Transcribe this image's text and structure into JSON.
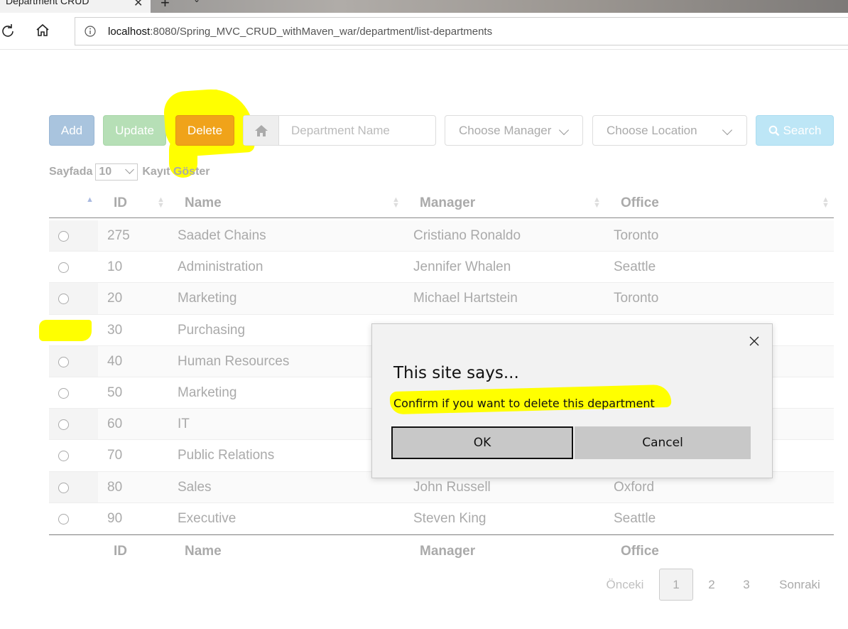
{
  "browser": {
    "tab_title": "Department CRUD",
    "url_host": "localhost",
    "url_rest": ":8080/Spring_MVC_CRUD_withMaven_war/department/list-departments"
  },
  "toolbar": {
    "add_label": "Add",
    "update_label": "Update",
    "delete_label": "Delete",
    "dept_placeholder": "Department Name",
    "manager_select": "Choose Manager",
    "location_select": "Choose Location",
    "search_label": "Search"
  },
  "length": {
    "prefix": "Sayfada",
    "value": "10",
    "suffix": "Kayıt Göster"
  },
  "table": {
    "headers": [
      "ID",
      "Name",
      "Manager",
      "Office"
    ],
    "rows": [
      {
        "id": "275",
        "name": "Saadet Chains",
        "manager": "Cristiano Ronaldo",
        "office": "Toronto",
        "checked": false
      },
      {
        "id": "10",
        "name": "Administration",
        "manager": "Jennifer Whalen",
        "office": "Seattle",
        "checked": false
      },
      {
        "id": "20",
        "name": "Marketing",
        "manager": "Michael Hartstein",
        "office": "Toronto",
        "checked": false
      },
      {
        "id": "30",
        "name": "Purchasing",
        "manager": "",
        "office": "",
        "checked": true
      },
      {
        "id": "40",
        "name": "Human Resources",
        "manager": "",
        "office": "",
        "checked": false
      },
      {
        "id": "50",
        "name": "Marketing",
        "manager": "",
        "office": "",
        "checked": false
      },
      {
        "id": "60",
        "name": "IT",
        "manager": "",
        "office": "",
        "checked": false
      },
      {
        "id": "70",
        "name": "Public Relations",
        "manager": "",
        "office": "",
        "checked": false
      },
      {
        "id": "80",
        "name": "Sales",
        "manager": "John Russell",
        "office": "Oxford",
        "checked": false
      },
      {
        "id": "90",
        "name": "Executive",
        "manager": "Steven King",
        "office": "Seattle",
        "checked": false
      }
    ]
  },
  "pagination": {
    "prev": "Önceki",
    "pages": [
      "1",
      "2",
      "3"
    ],
    "next": "Sonraki"
  },
  "dialog": {
    "title": "This site says...",
    "message": "Confirm if you want to delete this department",
    "ok_label": "OK",
    "cancel_label": "Cancel"
  },
  "colors": {
    "highlight": "#ffff00",
    "delete_button": "#f0a31a"
  }
}
